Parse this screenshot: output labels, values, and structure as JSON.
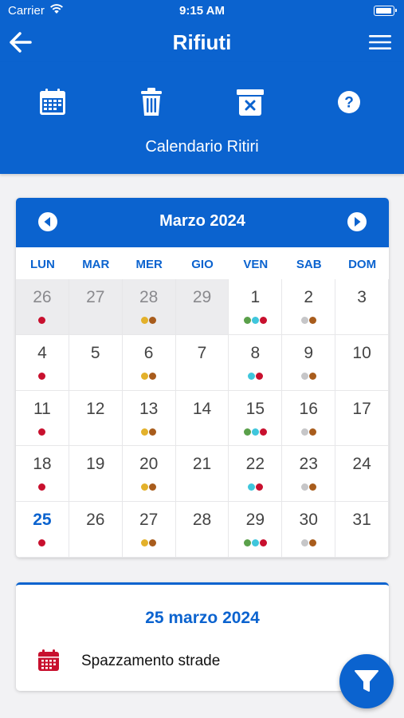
{
  "status_bar": {
    "carrier": "Carrier",
    "time": "9:15 AM"
  },
  "navbar": {
    "title": "Rifiuti",
    "back_icon": "back-arrow-icon",
    "menu_icon": "hamburger-menu-icon"
  },
  "toolbar": {
    "items": [
      {
        "name": "calendar",
        "icon": "calendar-icon"
      },
      {
        "name": "trash",
        "icon": "trash-icon"
      },
      {
        "name": "bin",
        "icon": "bin-x-icon"
      },
      {
        "name": "help",
        "icon": "help-icon"
      }
    ],
    "subtitle": "Calendario Ritiri"
  },
  "calendar": {
    "month_label": "Marzo 2024",
    "weekdays": [
      "LUN",
      "MAR",
      "MER",
      "GIO",
      "VEN",
      "SAB",
      "DOM"
    ],
    "colors": {
      "red": "#c8102e",
      "yellow": "#e3b12b",
      "brown": "#a85c1c",
      "green": "#5aa04a",
      "cyan": "#3fc6dc",
      "gray": "#c6c6c8"
    },
    "weeks": [
      [
        {
          "day": "26",
          "other": true,
          "dots": [
            "red"
          ]
        },
        {
          "day": "27",
          "other": true,
          "dots": []
        },
        {
          "day": "28",
          "other": true,
          "dots": [
            "yellow",
            "brown"
          ]
        },
        {
          "day": "29",
          "other": true,
          "dots": []
        },
        {
          "day": "1",
          "dots": [
            "green",
            "cyan",
            "red"
          ]
        },
        {
          "day": "2",
          "dots": [
            "gray",
            "brown"
          ]
        },
        {
          "day": "3",
          "dots": []
        }
      ],
      [
        {
          "day": "4",
          "dots": [
            "red"
          ]
        },
        {
          "day": "5",
          "dots": []
        },
        {
          "day": "6",
          "dots": [
            "yellow",
            "brown"
          ]
        },
        {
          "day": "7",
          "dots": []
        },
        {
          "day": "8",
          "dots": [
            "cyan",
            "red"
          ]
        },
        {
          "day": "9",
          "dots": [
            "gray",
            "brown"
          ]
        },
        {
          "day": "10",
          "dots": []
        }
      ],
      [
        {
          "day": "11",
          "dots": [
            "red"
          ]
        },
        {
          "day": "12",
          "dots": []
        },
        {
          "day": "13",
          "dots": [
            "yellow",
            "brown"
          ]
        },
        {
          "day": "14",
          "dots": []
        },
        {
          "day": "15",
          "dots": [
            "green",
            "cyan",
            "red"
          ]
        },
        {
          "day": "16",
          "dots": [
            "gray",
            "brown"
          ]
        },
        {
          "day": "17",
          "dots": []
        }
      ],
      [
        {
          "day": "18",
          "dots": [
            "red"
          ]
        },
        {
          "day": "19",
          "dots": []
        },
        {
          "day": "20",
          "dots": [
            "yellow",
            "brown"
          ]
        },
        {
          "day": "21",
          "dots": []
        },
        {
          "day": "22",
          "dots": [
            "cyan",
            "red"
          ]
        },
        {
          "day": "23",
          "dots": [
            "gray",
            "brown"
          ]
        },
        {
          "day": "24",
          "dots": []
        }
      ],
      [
        {
          "day": "25",
          "today": true,
          "dots": [
            "red"
          ]
        },
        {
          "day": "26",
          "dots": []
        },
        {
          "day": "27",
          "dots": [
            "yellow",
            "brown"
          ]
        },
        {
          "day": "28",
          "dots": []
        },
        {
          "day": "29",
          "dots": [
            "green",
            "cyan",
            "red"
          ]
        },
        {
          "day": "30",
          "dots": [
            "gray",
            "brown"
          ]
        },
        {
          "day": "31",
          "dots": []
        }
      ]
    ]
  },
  "selected_day": {
    "date_label": "25 marzo 2024",
    "events": [
      {
        "label": "Spazzamento strade",
        "icon": "calendar-icon",
        "color": "#c8102e"
      }
    ]
  },
  "fab": {
    "icon": "filter-icon"
  },
  "colors": {
    "primary": "#0b63cf"
  }
}
